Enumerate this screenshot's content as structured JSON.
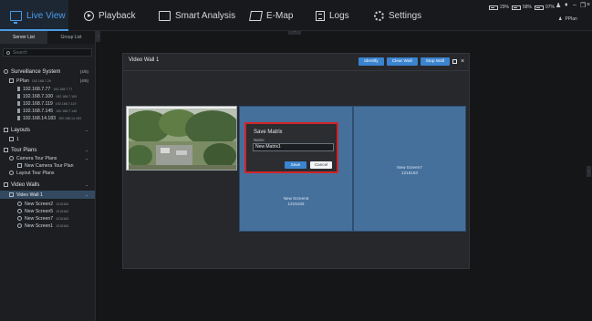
{
  "app": {
    "nav": [
      {
        "label": "Live View",
        "icon": "monitor-icon",
        "active": true
      },
      {
        "label": "Playback",
        "icon": "play-icon"
      },
      {
        "label": "Smart Analysis",
        "icon": "analysis-icon"
      },
      {
        "label": "E-Map",
        "icon": "map-icon"
      },
      {
        "label": "Logs",
        "icon": "logs-icon"
      },
      {
        "label": "Settings",
        "icon": "gear-icon"
      }
    ],
    "status": {
      "cpu": "29%",
      "memory": "58%",
      "network": "07%"
    },
    "user": "PPlan",
    "accent": "#4b9be8"
  },
  "sidebar": {
    "tabs": [
      "Server List",
      "Group List"
    ],
    "search_placeholder": "Search",
    "surveillance": {
      "label": "Surveillance System",
      "count": "(4/5)"
    },
    "server": {
      "label": "PPlan",
      "ip": "192.168.7.29",
      "count": "(4/5)"
    },
    "devices": [
      {
        "label": "192.168.7.77",
        "ip": "192.168.7.77"
      },
      {
        "label": "192.168.7.100",
        "ip": "192.168.7.100"
      },
      {
        "label": "192.168.7.119",
        "ip": "192.168.7.119"
      },
      {
        "label": "192.168.7.145",
        "ip": "192.168.7.145"
      },
      {
        "label": "192.168.14.183",
        "ip": "192.168.14.183"
      }
    ],
    "layouts": {
      "label": "Layouts",
      "item": "1"
    },
    "tour_plans": {
      "label": "Tour Plans",
      "camera_tour": "Camera Tour Plans",
      "new_camera_tour": "New Camera Tour Plan",
      "layout_tour": "Layout Tour Plans"
    },
    "video_walls": {
      "label": "Video Walls",
      "selected": "Video Wall 1",
      "screens": [
        {
          "label": "New Screen2",
          "sub": "1215163"
        },
        {
          "label": "New Screen5",
          "sub": "1215163"
        },
        {
          "label": "New Screen7",
          "sub": "1215163"
        },
        {
          "label": "New Screen1",
          "sub": "1215163"
        }
      ]
    }
  },
  "dialog": {
    "title": "Video Wall 1",
    "identify": "Identify",
    "clear_wall": "Clear Wall",
    "stop_wall": "Stop Wall",
    "screens": [
      {
        "label": "New Screen6",
        "sub": "1215163"
      },
      {
        "label": "New Screen7",
        "sub": "1215163"
      }
    ]
  },
  "save_matrix": {
    "title": "Save Matrix",
    "name_label": "Name",
    "name_value": "New Matrix1",
    "save": "Save",
    "cancel": "Cancel",
    "highlight": "#d1242a"
  }
}
